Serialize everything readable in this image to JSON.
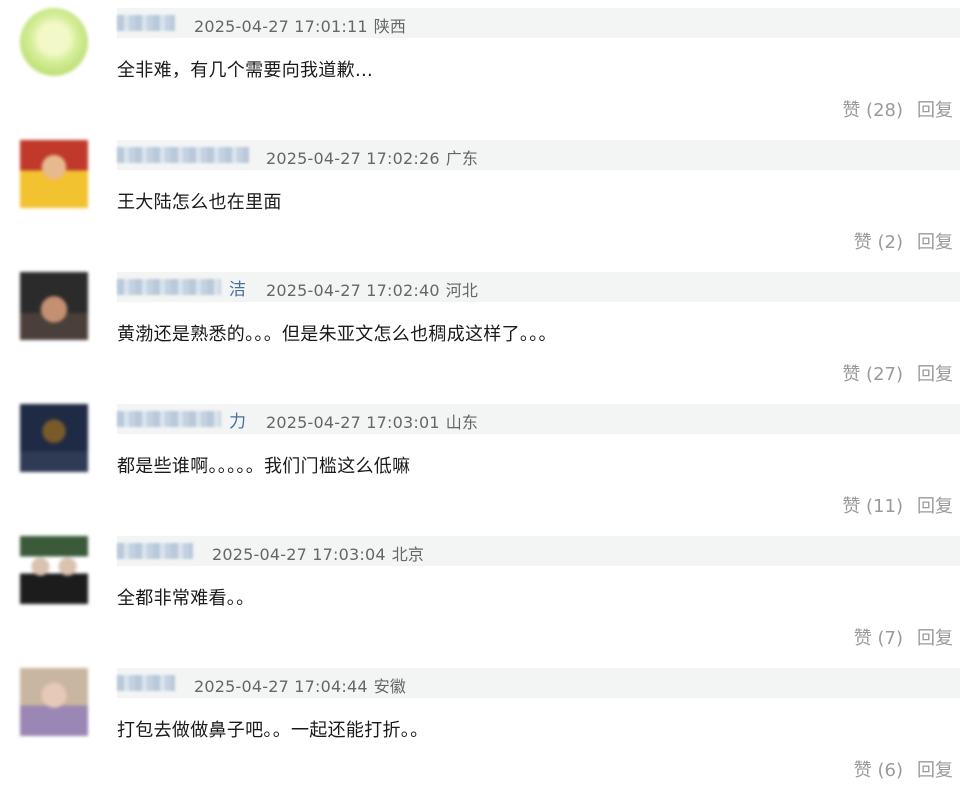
{
  "comments": [
    {
      "timestamp": "2025-04-27 17:01:11",
      "location": "陕西",
      "username_tail": "",
      "text": "全非难，有几个需要向我道歉…",
      "like_label": "赞 (28)",
      "reply_label": "回复",
      "avatar_colors": [
        "#d6ef9a",
        "#f3f8c8",
        "#bfe07a"
      ]
    },
    {
      "timestamp": "2025-04-27 17:02:26",
      "location": "广东",
      "username_tail": "",
      "text": "王大陆怎么也在里面",
      "like_label": "赞 (2)",
      "reply_label": "回复",
      "avatar_colors": [
        "#c0392b",
        "#e8b98f",
        "#f2c230"
      ]
    },
    {
      "timestamp": "2025-04-27 17:02:40",
      "location": "河北",
      "username_tail": "洁",
      "text": "黄渤还是熟悉的。。。但是朱亚文怎么也稠成这样了。。。",
      "like_label": "赞 (27)",
      "reply_label": "回复",
      "avatar_colors": [
        "#2b2b2b",
        "#c48f72",
        "#4a3f3a"
      ]
    },
    {
      "timestamp": "2025-04-27 17:03:01",
      "location": "山东",
      "username_tail": "力",
      "text": "都是些谁啊。。。。。我们门槛这么低嘛",
      "like_label": "赞 (11)",
      "reply_label": "回复",
      "avatar_colors": [
        "#1f2a44",
        "#7a5a2a",
        "#2f3a55"
      ]
    },
    {
      "timestamp": "2025-04-27 17:03:04",
      "location": "北京",
      "username_tail": "",
      "text": "全都非常难看。。",
      "like_label": "赞 (7)",
      "reply_label": "回复",
      "avatar_colors": [
        "#3a5a3a",
        "#d9c2b0",
        "#1c1c1c"
      ]
    },
    {
      "timestamp": "2025-04-27 17:04:44",
      "location": "安徽",
      "username_tail": "",
      "text": "打包去做做鼻子吧。。一起还能打折。。",
      "like_label": "赞 (6)",
      "reply_label": "回复",
      "avatar_colors": [
        "#c9b6a0",
        "#e7c9b8",
        "#9a87b5"
      ]
    }
  ]
}
